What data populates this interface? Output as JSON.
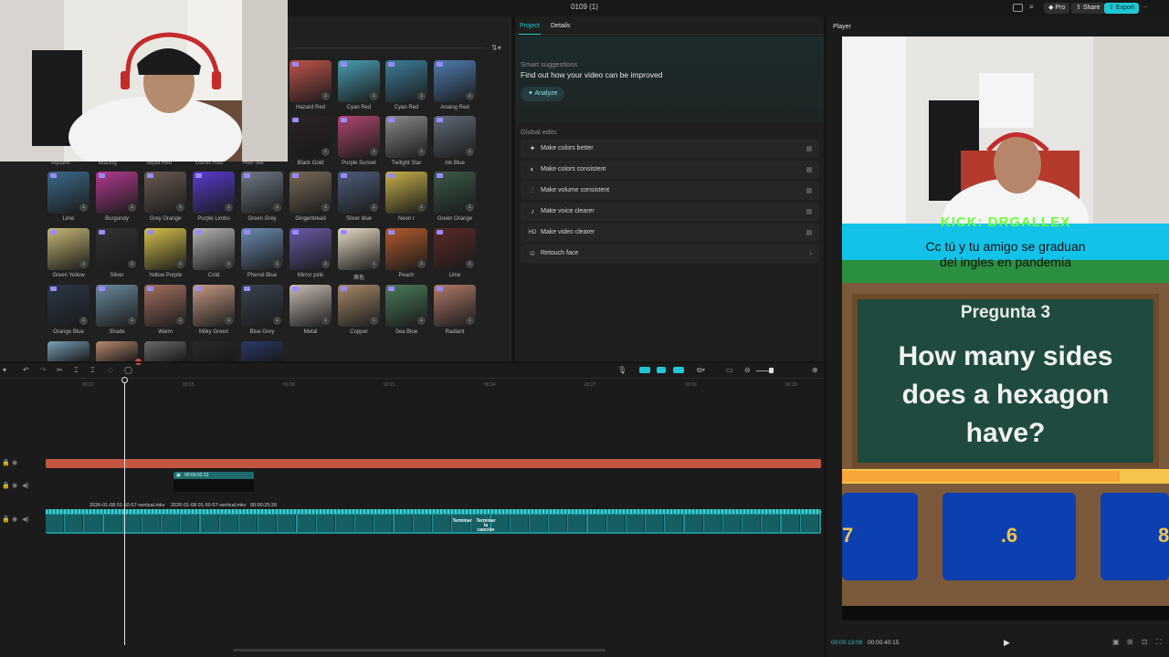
{
  "topbar": {
    "project_title": "0109 (1)",
    "pro_label": "Pro",
    "share_label": "Share",
    "export_label": "Export"
  },
  "colors": {
    "accent": "#1fc7d4",
    "track_red": "#c35741",
    "clip_teal": "#1e8f93",
    "pro_badge": "#9b8cff"
  },
  "filters": [
    {
      "label": "Hazard Red",
      "color": "#c0544b"
    },
    {
      "label": "Cyan Red",
      "color": "#4a9fb3"
    },
    {
      "label": "Cyan Red",
      "color": "#3c7f9a"
    },
    {
      "label": "Analog Red",
      "color": "#4f7db1"
    },
    {
      "label": "Black Gold",
      "color": "#2c2226"
    },
    {
      "label": "Purple Sunset",
      "color": "#b0466f"
    },
    {
      "label": "Twilight Star",
      "color": "#8a8a8a"
    },
    {
      "label": "Ink Blue",
      "color": "#5f6a78"
    },
    {
      "label": "Lime",
      "color": "#3c6a8a"
    },
    {
      "label": "Burgundy",
      "color": "#b33a8f"
    },
    {
      "label": "Grey Orange",
      "color": "#6b5a52"
    },
    {
      "label": "Purple Limbo",
      "color": "#5a3bd2"
    },
    {
      "label": "Green Grey",
      "color": "#6e7a86"
    },
    {
      "label": "Gingerbread",
      "color": "#7a6a58"
    },
    {
      "label": "Silver blue",
      "color": "#4c5e7a"
    },
    {
      "label": "Neon r",
      "color": "#c8b24a"
    },
    {
      "label": "Green Orange",
      "color": "#3b5a48"
    },
    {
      "label": "Green Yellow",
      "color": "#c7b774"
    },
    {
      "label": "Silver",
      "color": "#333333"
    },
    {
      "label": "Yellow Purple",
      "color": "#d5c24c"
    },
    {
      "label": "Cold",
      "color": "#b7b4b2"
    },
    {
      "label": "Phenol Blue",
      "color": "#6b8cb0"
    },
    {
      "label": "Mirror pink",
      "color": "#6b5aa8"
    },
    {
      "label": "茜色",
      "color": "#e9dcc6"
    },
    {
      "label": "Peach",
      "color": "#b45a2c"
    },
    {
      "label": "Lime",
      "color": "#5a2a26"
    },
    {
      "label": "Orange Blue",
      "color": "#2b3848"
    },
    {
      "label": "Shade",
      "color": "#6a8a9e"
    },
    {
      "label": "Warm",
      "color": "#a57060"
    },
    {
      "label": "Milky Green",
      "color": "#c59a84"
    },
    {
      "label": "Blue Grey",
      "color": "#3a4452"
    },
    {
      "label": "Metal",
      "color": "#c8bcb2"
    },
    {
      "label": "Copper",
      "color": "#a88a6a"
    },
    {
      "label": "Sea Blue",
      "color": "#4a7a5a"
    },
    {
      "label": "Radiant",
      "color": "#b07a6a"
    }
  ],
  "filters_partial_labels": [
    "Aquarel",
    "Blazing",
    "Sepia Red",
    "Gothic Red",
    "Red Tea"
  ],
  "project_panel": {
    "tab_project": "Project",
    "tab_details": "Details",
    "smart_title": "Smart suggestions",
    "smart_subtitle": "Find out how your video can be improved",
    "analyze_label": "Analyze",
    "global_title": "Global edits",
    "global_edits": [
      {
        "icon": "✦",
        "label": "Make colors better"
      },
      {
        "icon": "◐",
        "label": "Make colors consistent"
      },
      {
        "icon": "⫶",
        "label": "Make volume consistent"
      },
      {
        "icon": "♪",
        "label": "Make voice clearer"
      },
      {
        "icon": "HD",
        "label": "Make video clearer"
      },
      {
        "icon": "☺",
        "label": "Retouch face"
      }
    ]
  },
  "player": {
    "title": "Player",
    "current_time": "00:00:13:09",
    "total_time": "00:00:40:15",
    "overlay_channel": "KICK: DRGALLEX",
    "caption_line1": "Cc tú y tu amigo se graduan",
    "caption_line2": "del ingles en pandemia",
    "quiz_header": "Pregunta 3",
    "quiz_question": "How many sides does a hexagon have?",
    "quiz_answers": [
      "7",
      ".6",
      "8"
    ],
    "timer_fraction": 0.85
  },
  "timeline": {
    "ruler": [
      "00:12",
      "00:15",
      "00:18",
      "00:21",
      "00:24",
      "00:27",
      "00:30",
      "00:33"
    ],
    "clip_audio_time": "00:00:02:13",
    "clip1_name": "2026-01-08 01-50-57-vertical.mkv",
    "clip2_name": "2026-01-08 01-50-57-vertical.mkv",
    "clip2_time": "00:00:25:26",
    "strip_labels": [
      "Terminar",
      "Terminar la canción"
    ]
  }
}
